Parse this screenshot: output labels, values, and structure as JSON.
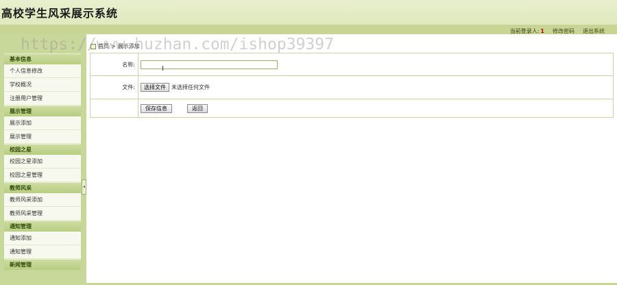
{
  "header": {
    "app_title": "高校学生风采展示系统",
    "current_user_label": "当前登录人:",
    "current_user_value": "1",
    "change_password": "修改密码",
    "logout": "退出系统"
  },
  "watermark": "https://www.huzhan.com/ishop39397",
  "breadcrumb": {
    "home": "首页",
    "separator": ">",
    "current": "展示添加"
  },
  "sidebar": {
    "groups": [
      {
        "title": "基本信息",
        "items": [
          "个人信息修改",
          "学校概况",
          "注册用户管理"
        ]
      },
      {
        "title": "展示管理",
        "items": [
          "展示添加",
          "展示管理"
        ]
      },
      {
        "title": "校园之星",
        "items": [
          "校园之星添加",
          "校园之星管理"
        ]
      },
      {
        "title": "教师风采",
        "items": [
          "教师风采添加",
          "教师风采管理"
        ]
      },
      {
        "title": "通知管理",
        "items": [
          "通知添加",
          "通知管理"
        ]
      },
      {
        "title": "新闻管理",
        "items": []
      }
    ]
  },
  "form": {
    "name_label": "名称:",
    "name_value": "",
    "file_label": "文件:",
    "file_button": "选择文件",
    "file_status": "未选择任何文件",
    "save_button": "保存信息",
    "back_button": "返回"
  },
  "colors": {
    "accent": "#c7d695",
    "header_bg": "#e4ebc6",
    "border": "#b7c98c"
  }
}
